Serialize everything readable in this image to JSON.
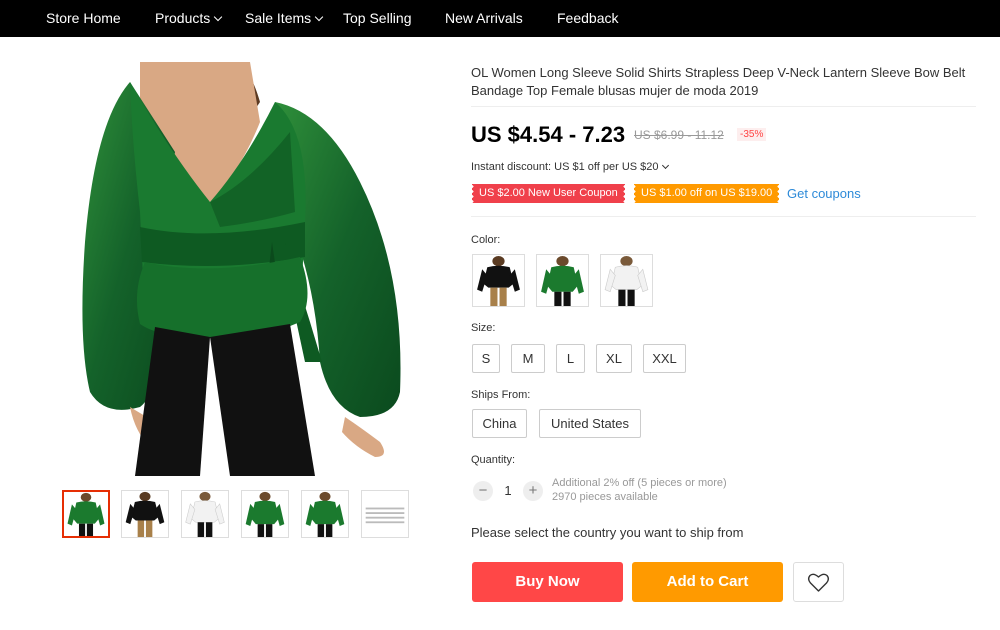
{
  "nav": {
    "store_home": "Store Home",
    "products": "Products",
    "sale_items": "Sale Items",
    "top_selling": "Top Selling",
    "new_arrivals": "New Arrivals",
    "feedback": "Feedback"
  },
  "product": {
    "title": "OL Women Long Sleeve Solid Shirts Strapless Deep V-Neck Lantern Sleeve Bow Belt Bandage Top Female blusas mujer de moda 2019",
    "price": "US $4.54 - 7.23",
    "old_price": "US $6.99 - 11.12",
    "discount": "-35%",
    "instant_discount": "Instant discount: US $1 off per US $20",
    "coupon_new_user": "US $2.00 New User Coupon",
    "coupon_off": "US $1.00 off on US $19.00",
    "get_coupons": "Get coupons"
  },
  "options": {
    "color_label": "Color:",
    "size_label": "Size:",
    "sizes": [
      "S",
      "M",
      "L",
      "XL",
      "XXL"
    ],
    "ships_label": "Ships From:",
    "ships_from": [
      "China",
      "United States"
    ],
    "quantity_label": "Quantity:",
    "quantity": "1",
    "qty_note_1": "Additional 2% off (5 pieces or more)",
    "qty_note_2": "2970 pieces available"
  },
  "ship_message": "Please select the country you want to ship from",
  "actions": {
    "buy_now": "Buy Now",
    "add_to_cart": "Add to Cart"
  },
  "colors": {
    "accent_red": "#ff4747",
    "accent_orange": "#ff9a00",
    "link_blue": "#2d8ad8"
  }
}
